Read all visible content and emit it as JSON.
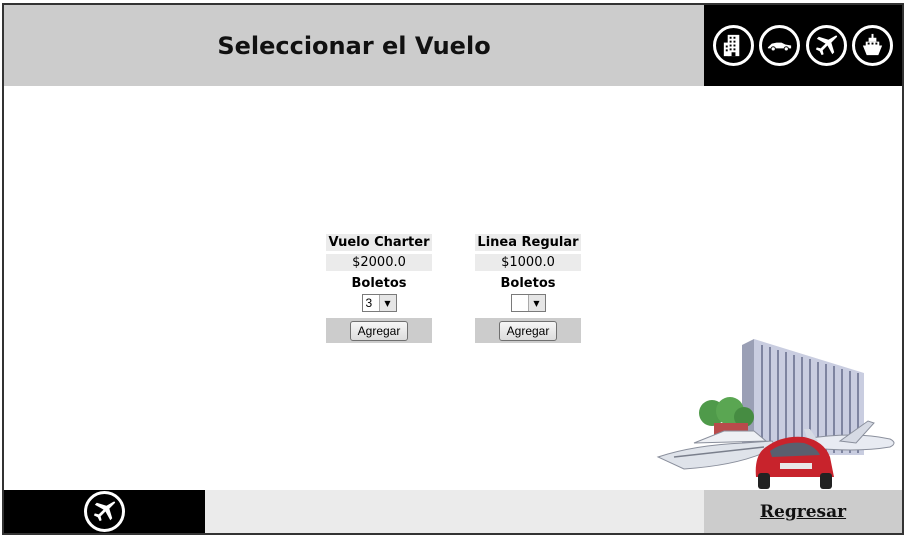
{
  "header": {
    "title": "Seleccionar el Vuelo",
    "icons": [
      "hotel-icon",
      "car-icon",
      "plane-icon",
      "ship-icon"
    ]
  },
  "flights": [
    {
      "name": "Vuelo Charter",
      "price": "$2000.0",
      "tickets_label": "Boletos",
      "tickets_value": "3",
      "add_label": "Agregar"
    },
    {
      "name": "Linea Regular",
      "price": "$1000.0",
      "tickets_label": "Boletos",
      "tickets_value": "",
      "add_label": "Agregar"
    }
  ],
  "footer": {
    "left_icon": "plane-icon",
    "back_label": "Regresar"
  },
  "colors": {
    "header_bg": "#cccccc",
    "icon_bar_bg": "#000000",
    "card_label_bg": "#ebebeb",
    "footer_mid_bg": "#ebebeb"
  }
}
